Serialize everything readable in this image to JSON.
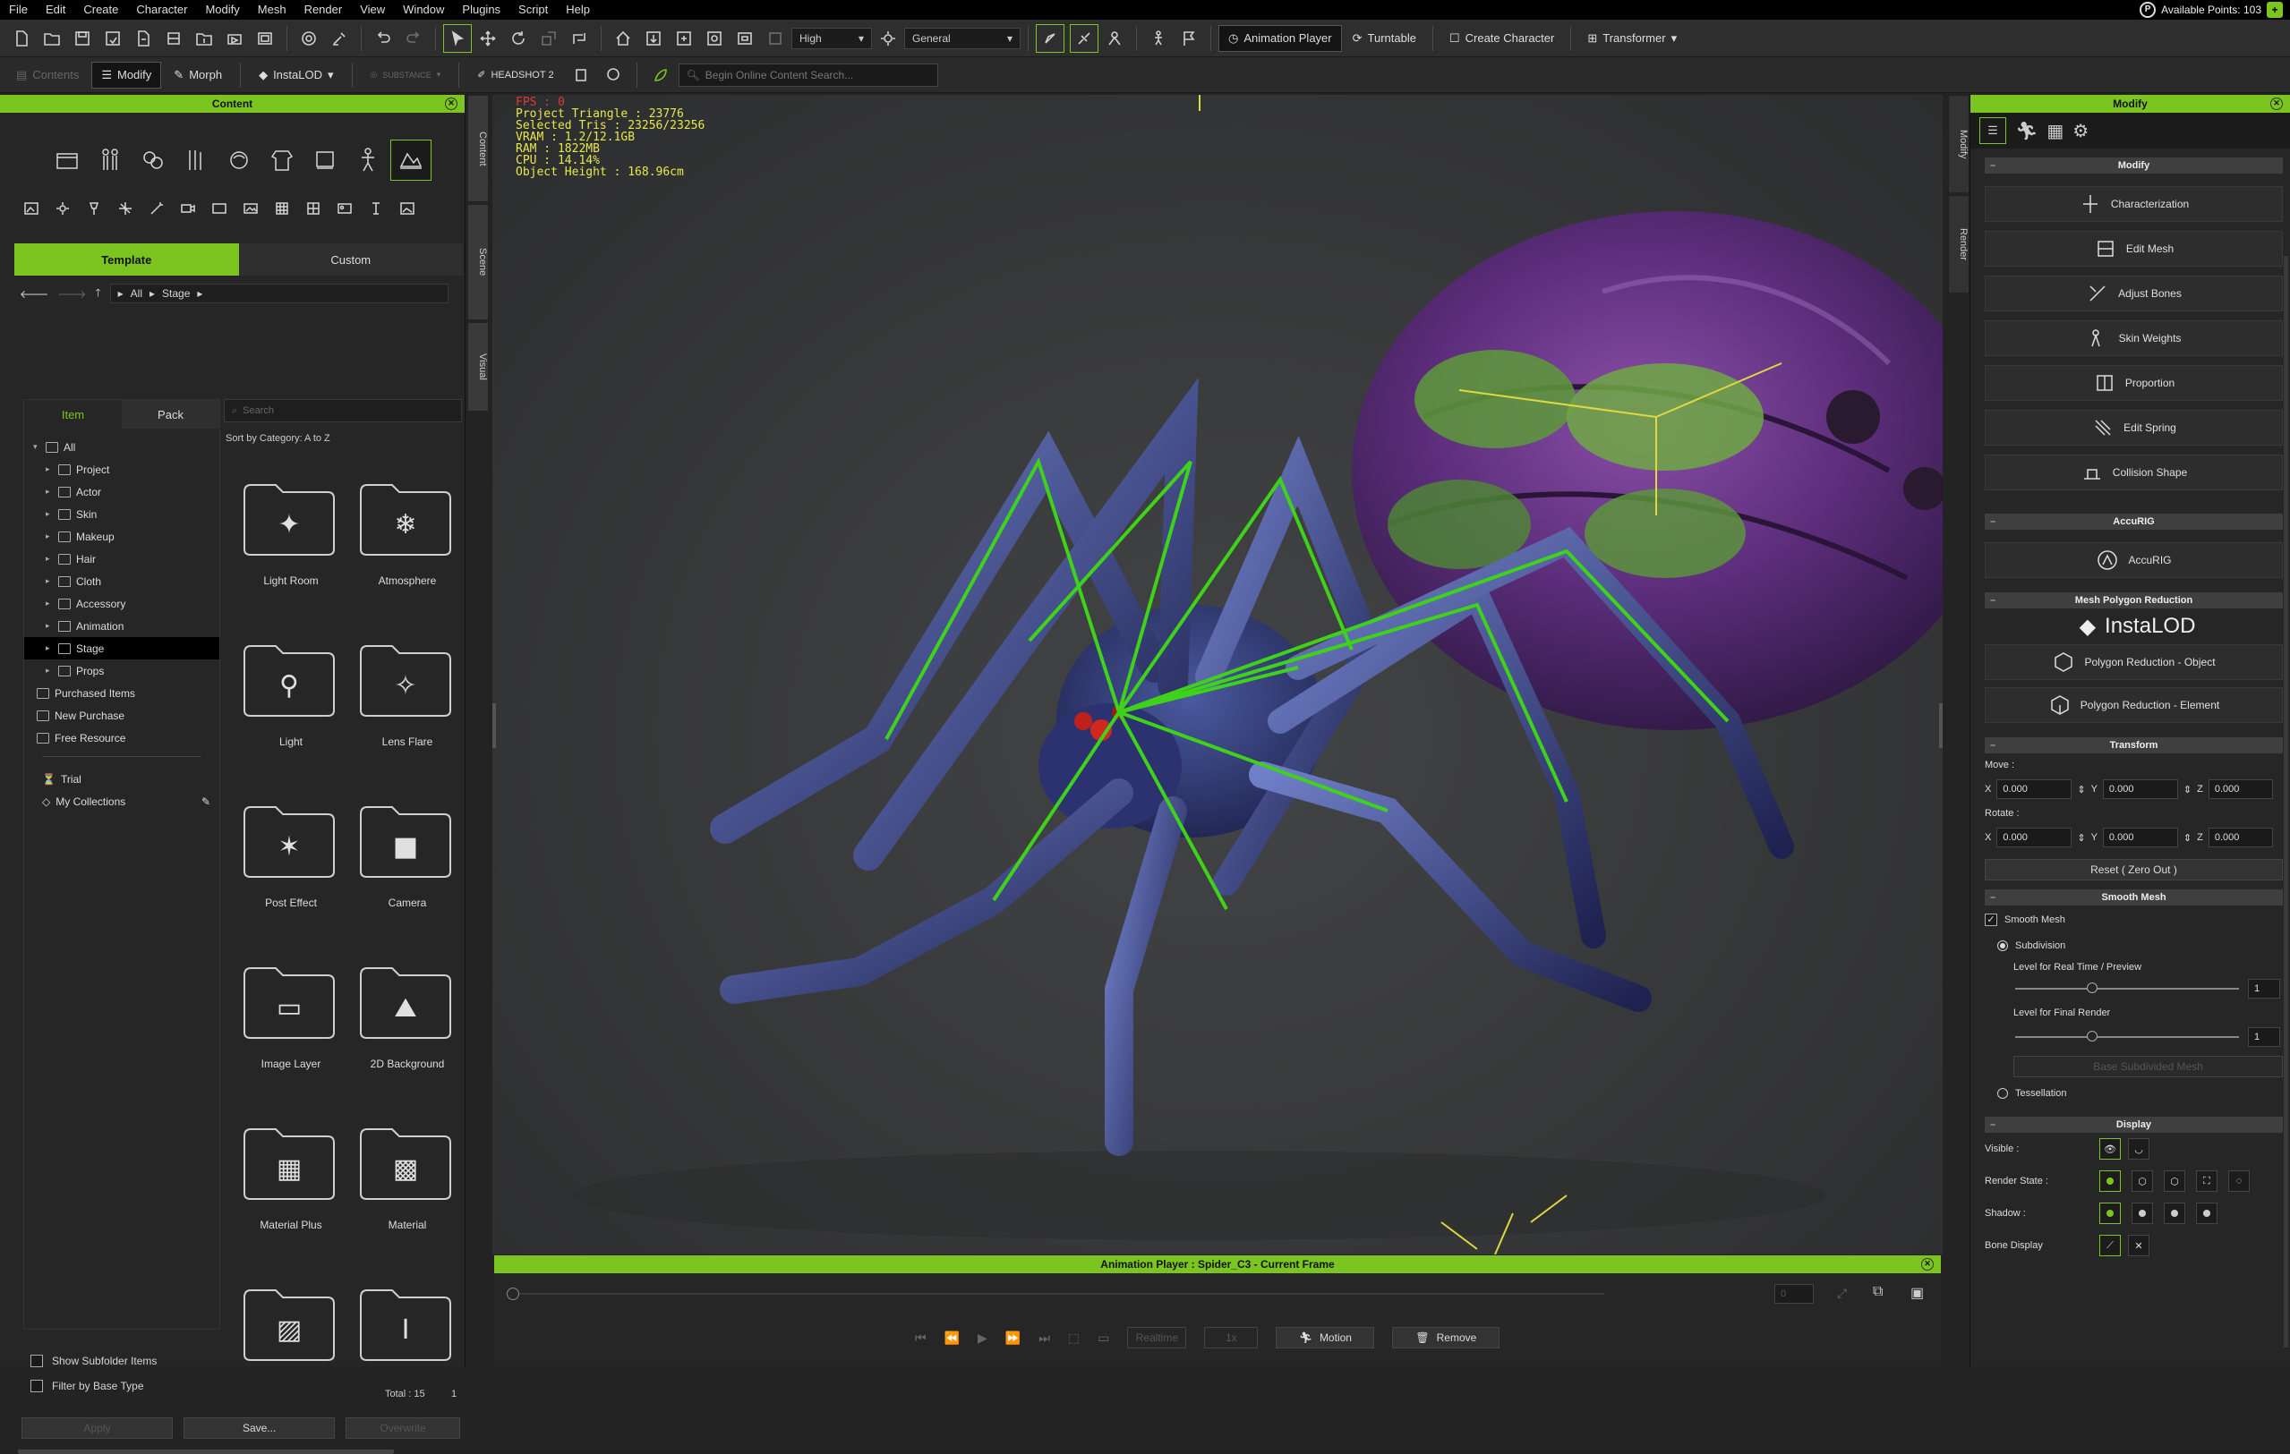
{
  "menu": [
    "File",
    "Edit",
    "Create",
    "Character",
    "Modify",
    "Mesh",
    "Render",
    "View",
    "Window",
    "Plugins",
    "Script",
    "Help"
  ],
  "points": {
    "label": "Available Points: 103",
    "plus": "+"
  },
  "toolbar": {
    "quality": "High",
    "shading": "General",
    "animation_player": "Animation Player",
    "turntable": "Turntable",
    "create_character": "Create Character",
    "transformer": "Transformer",
    "contents": "Contents",
    "modify": "Modify",
    "morph": "Morph",
    "instalod": "InstaLOD",
    "substance": "SUBSTANCE",
    "headshot": "HEADSHOT 2",
    "search_placeholder": "Begin Online Content Search..."
  },
  "content_panel": {
    "title": "Content",
    "tabs": [
      "Template",
      "Custom"
    ],
    "subtabs": [
      "Item",
      "Pack"
    ],
    "path": [
      "All",
      "Stage"
    ],
    "search_placeholder": "Search",
    "sort": "Sort by Category: A to Z",
    "tree": [
      {
        "label": "All",
        "arrow": "▾",
        "indent": 0
      },
      {
        "label": "Project",
        "arrow": "▸",
        "indent": 1
      },
      {
        "label": "Actor",
        "arrow": "▸",
        "indent": 1
      },
      {
        "label": "Skin",
        "arrow": "▸",
        "indent": 1
      },
      {
        "label": "Makeup",
        "arrow": "▸",
        "indent": 1
      },
      {
        "label": "Hair",
        "arrow": "▸",
        "indent": 1
      },
      {
        "label": "Cloth",
        "arrow": "▸",
        "indent": 1
      },
      {
        "label": "Accessory",
        "arrow": "▸",
        "indent": 1
      },
      {
        "label": "Animation",
        "arrow": "▸",
        "indent": 1
      },
      {
        "label": "Stage",
        "arrow": "▸",
        "indent": 1,
        "selected": true
      },
      {
        "label": "Props",
        "arrow": "▸",
        "indent": 1
      }
    ],
    "extra": [
      "Purchased Items",
      "New Purchase",
      "Free Resource"
    ],
    "trial": "Trial",
    "collections": "My Collections",
    "tiles": [
      "Light Room",
      "Atmosphere",
      "Light",
      "Lens Flare",
      "Post Effect",
      "Camera",
      "Image Layer",
      "2D Background",
      "Material Plus",
      "Material",
      "",
      ""
    ],
    "show_subfolder": "Show Subfolder Items",
    "filter_base": "Filter by Base Type",
    "total": "Total : 15",
    "page": "1",
    "buttons": [
      "Apply",
      "Save...",
      "Overwrite"
    ]
  },
  "side_tabs": [
    "Content",
    "Scene",
    "Visual"
  ],
  "stats": {
    "fps": "FPS : 0",
    "lines": [
      "Project Triangle : 23776",
      "Selected Tris : 23256/23256",
      "VRAM : 1.2/12.1GB",
      "RAM : 1822MB",
      "CPU : 14.14%",
      "Object Height : 168.96cm"
    ]
  },
  "animation_player": {
    "title": "Animation Player : Spider_C3 - Current Frame",
    "frame": "0",
    "realtime": "Realtime",
    "speed": "1x",
    "motion": "Motion",
    "remove": "Remove"
  },
  "right_tabs": [
    "Modify",
    "Render"
  ],
  "modify_panel": {
    "title": "Modify",
    "sections": {
      "modify": "Modify",
      "accurig": "AccuRIG",
      "reduction": "Mesh Polygon Reduction",
      "transform": "Transform",
      "smooth": "Smooth Mesh",
      "display": "Display"
    },
    "modify_buttons": [
      "Characterization",
      "Edit Mesh",
      "Adjust Bones",
      "Skin Weights",
      "Proportion",
      "Edit Spring",
      "Collision Shape"
    ],
    "accurig_button": "AccuRIG",
    "instalod_logo": "InstaLOD",
    "reduction_buttons": [
      "Polygon Reduction - Object",
      "Polygon Reduction - Element"
    ],
    "move_label": "Move :",
    "rotate_label": "Rotate :",
    "axes": [
      "X",
      "Y",
      "Z"
    ],
    "move": [
      "0.000",
      "0.000",
      "0.000"
    ],
    "rotate": [
      "0.000",
      "0.000",
      "0.000"
    ],
    "reset": "Reset ( Zero Out )",
    "smooth_mesh": "Smooth Mesh",
    "subdivision": "Subdivision",
    "level_rt": "Level for Real Time / Preview",
    "level_rt_value": "1",
    "level_final": "Level for Final Render",
    "level_final_value": "1",
    "base_subdivided": "Base Subdivided Mesh",
    "tessellation": "Tessellation",
    "visible": "Visible :",
    "render_state": "Render State :",
    "shadow": "Shadow :",
    "bone_display": "Bone Display"
  },
  "colors": {
    "accent": "#7cc520",
    "bone": "#3fd21a",
    "stats": "#e8e84a"
  }
}
